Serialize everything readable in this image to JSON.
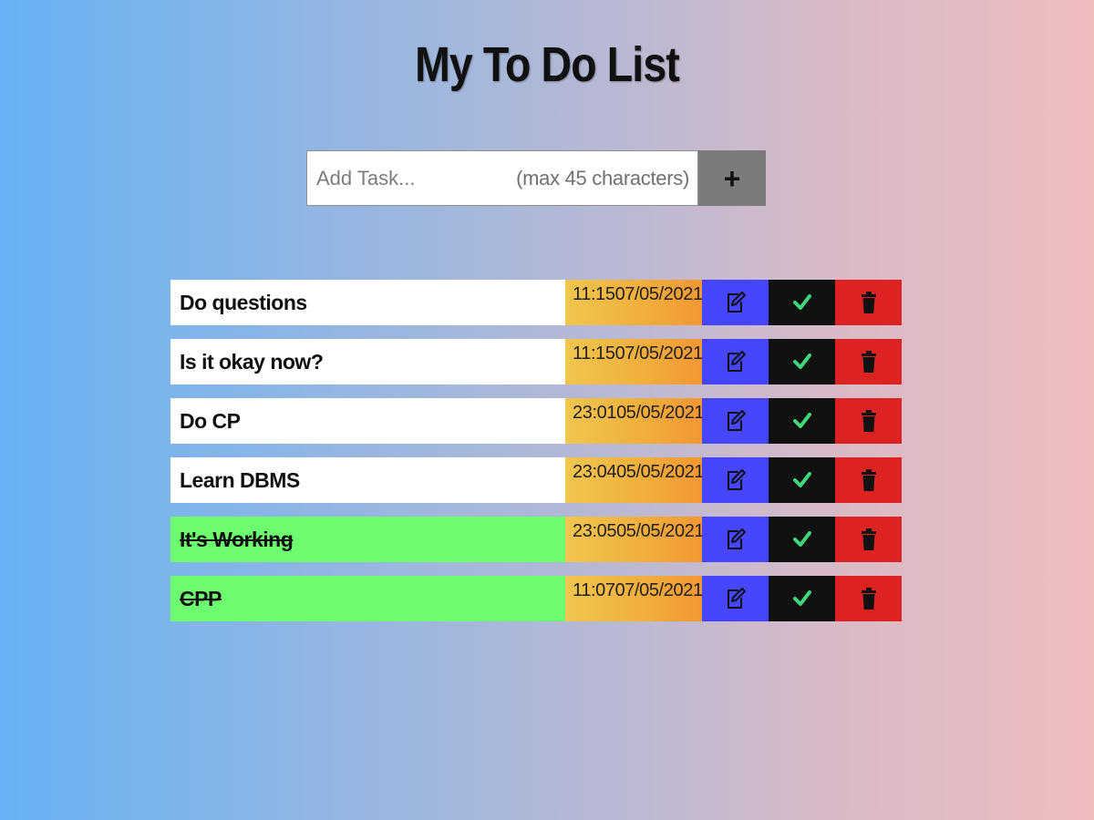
{
  "page": {
    "title": "My To Do List"
  },
  "add_task": {
    "placeholder": "Add Task...",
    "hint": "(max 45 characters)",
    "button_label": "+"
  },
  "tasks": [
    {
      "text": "Do questions",
      "time": "11:15",
      "date": "07/05/2021",
      "completed": false
    },
    {
      "text": "Is it okay now?",
      "time": "11:15",
      "date": "07/05/2021",
      "completed": false
    },
    {
      "text": "Do CP",
      "time": "23:01",
      "date": "05/05/2021",
      "completed": false
    },
    {
      "text": "Learn DBMS",
      "time": "23:04",
      "date": "05/05/2021",
      "completed": false
    },
    {
      "text": "It's Working",
      "time": "23:05",
      "date": "05/05/2021",
      "completed": true
    },
    {
      "text": "CPP",
      "time": "11:07",
      "date": "07/05/2021",
      "completed": true
    }
  ],
  "icons": {
    "edit": "edit-icon",
    "complete": "check-icon",
    "delete": "trash-icon"
  },
  "colors": {
    "edit_button": "#4646ff",
    "complete_button": "#111111",
    "delete_button": "#dd2222",
    "completed_task": "#6dfb6f",
    "check_mark": "#3fd67a"
  }
}
